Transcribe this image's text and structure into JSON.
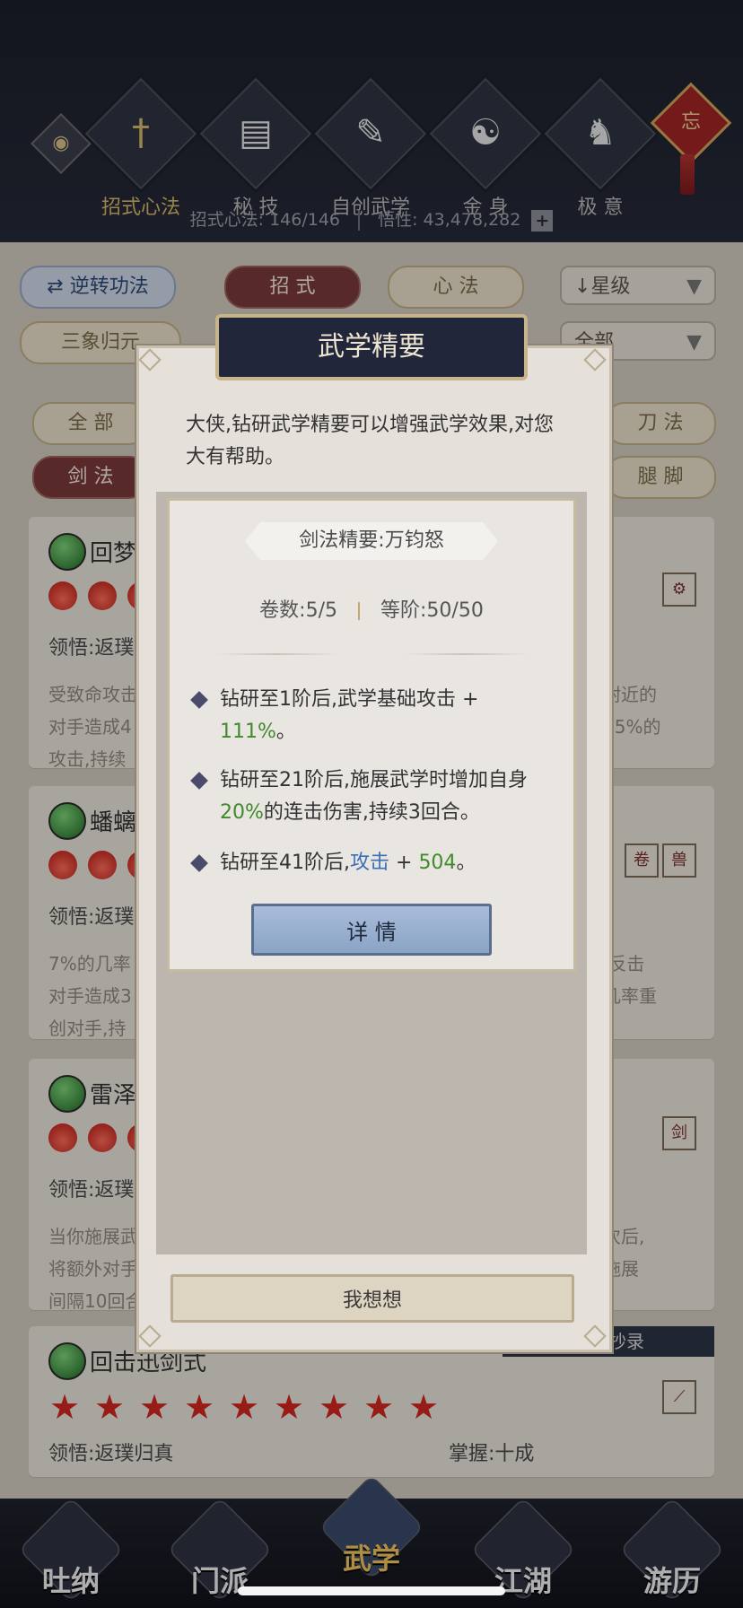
{
  "header": {
    "categories": [
      {
        "label": "招式心法",
        "icon": "sword-icon"
      },
      {
        "label": "秘 技",
        "icon": "book-icon"
      },
      {
        "label": "自创武学",
        "icon": "scroll-icon"
      },
      {
        "label": "金 身",
        "icon": "meditation-icon"
      },
      {
        "label": "极 意",
        "icon": "fighter-icon"
      }
    ],
    "knot_text": "忘",
    "stats_label1": "招式心法:",
    "stats_value1": "146/146",
    "stats_label2": "悟性:",
    "stats_value2": "43,478,282",
    "plus": "+"
  },
  "filters": {
    "reverse": "逆转功法",
    "tab_zhaoshi": "招 式",
    "tab_xinfa": "心 法",
    "sort": "星级",
    "sanxiang": "三象归元",
    "all_select": "全部",
    "all": "全 部",
    "dao": "刀 法",
    "jian": "剑 法",
    "tui": "腿 脚"
  },
  "cards": [
    {
      "name": "回梦",
      "ling": "领悟:返璞",
      "desc1": "受致命攻击",
      "desc2": "对手造成4",
      "desc3": "攻击,持续",
      "right1": "附近的",
      "right2": "35%的"
    },
    {
      "name": "蟠螭",
      "ling": "领悟:返璞",
      "desc1": "7%的几率",
      "desc2": "对手造成3",
      "desc3": "创对手,持",
      "right1": ",反击",
      "right2": "几率重"
    },
    {
      "name": "雷泽",
      "ling": "领悟:返璞",
      "desc1": "当你施展武",
      "desc2": "将额外对手",
      "desc3": "间隔10回合",
      "right1": "次后,",
      "right2": "施展"
    },
    {
      "name": "回击迅剑式",
      "ling": "领悟:返璞归真",
      "mastery": "掌握:十成",
      "copied": "楼已抄录"
    }
  ],
  "dialog": {
    "title": "武学精要",
    "intro": "大侠,钻研武学精要可以增强武学效果,对您大有帮助。",
    "essence_title": "剑法精要:万钧怒",
    "volumes": "卷数:5/5",
    "rank": "等阶:50/50",
    "bullets": {
      "b1_prefix": "钻研至1阶后,武学基础攻击 +",
      "b1_value": "111%",
      "b1_suffix": "。",
      "b2_prefix": "钻研至21阶后,施展武学时增加自身",
      "b2_value": "20%",
      "b2_suffix": "的连击伤害,持续3回合。",
      "b3_prefix": "钻研至41阶后,",
      "b3_attr": "攻击",
      "b3_plus": " + ",
      "b3_value": "504",
      "b3_suffix": "。"
    },
    "detail_button": "详 情",
    "think_button": "我想想"
  },
  "bottom_nav": [
    "吐纳",
    "门派",
    "武学",
    "江湖",
    "游历"
  ],
  "colors": {
    "accent_green": "#3f8a2a",
    "accent_blue": "#3b6fb8",
    "star_red": "#d4261e"
  }
}
